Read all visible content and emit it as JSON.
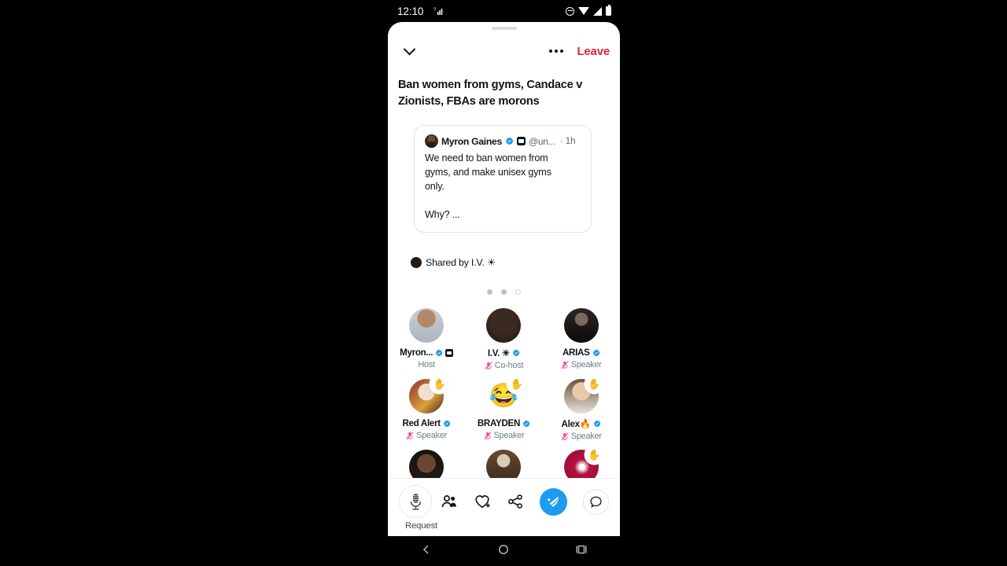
{
  "status_bar": {
    "time": "12:10",
    "icons": [
      "signal-small-icon",
      "do-not-disturb-icon",
      "wifi-icon",
      "cellular-icon",
      "battery-icon"
    ]
  },
  "header": {
    "collapse_icon": "chevron-down-icon",
    "more_icon": "more-horizontal-icon",
    "leave_label": "Leave",
    "leave_color": "#d72638"
  },
  "room": {
    "title": "Ban women from gyms, Candace v\nZionists, FBAs are morons"
  },
  "quoted_tweet": {
    "author": "Myron Gaines",
    "verified_icon": "verified-badge-icon",
    "affiliate_icon": "affiliate-badge-icon",
    "handle": "@un...",
    "timestamp": "· 1h",
    "body": "We need to ban women from\ngyms, and make unisex gyms\nonly.\n\nWhy? ..."
  },
  "shared_by": {
    "text": "Shared by I.V. ☀"
  },
  "pagination": {
    "dots": [
      "filled",
      "filled",
      "hollow"
    ]
  },
  "speakers": [
    [
      {
        "name": "Myron...",
        "role": "Host",
        "verified": true,
        "affiliate": true,
        "muted": false,
        "hand_raised": false,
        "avatar": "photo-man-beard",
        "avatar_kind": "photo"
      },
      {
        "name": "I.V. ☀",
        "role": "Co-host",
        "verified": true,
        "affiliate": false,
        "muted": true,
        "hand_raised": false,
        "avatar": "photo-dark",
        "avatar_kind": "photo"
      },
      {
        "name": "ARIAS",
        "role": "Speaker",
        "verified": true,
        "affiliate": false,
        "muted": true,
        "hand_raised": false,
        "avatar": "photo-figure-dark",
        "avatar_kind": "photo"
      }
    ],
    [
      {
        "name": "Red Alert",
        "role": "Speaker",
        "verified": true,
        "affiliate": false,
        "muted": true,
        "hand_raised": true,
        "avatar": "photo-clown",
        "avatar_kind": "photo"
      },
      {
        "name": "BRAYDEN",
        "role": "Speaker",
        "verified": true,
        "affiliate": false,
        "muted": true,
        "hand_raised": true,
        "avatar": "😂",
        "avatar_kind": "emoji"
      },
      {
        "name": "Alex🔥",
        "role": "Speaker",
        "verified": true,
        "affiliate": false,
        "muted": true,
        "hand_raised": true,
        "avatar": "photo-person",
        "avatar_kind": "photo"
      }
    ],
    [
      {
        "name": "",
        "role": "",
        "verified": false,
        "affiliate": false,
        "muted": false,
        "hand_raised": false,
        "avatar": "photo-woman",
        "avatar_kind": "photo"
      },
      {
        "name": "",
        "role": "",
        "verified": false,
        "affiliate": false,
        "muted": false,
        "hand_raised": false,
        "avatar": "photo-portrait",
        "avatar_kind": "photo"
      },
      {
        "name": "",
        "role": "",
        "verified": false,
        "affiliate": false,
        "muted": false,
        "hand_raised": true,
        "avatar": "photo-red-burst",
        "avatar_kind": "photo"
      }
    ]
  ],
  "action_bar": {
    "request_label": "Request",
    "mic_icon": "microphone-icon",
    "people_icon": "people-icon",
    "heart_plus_icon": "heart-plus-icon",
    "share_icon": "share-icon",
    "compose_icon": "compose-tweet-icon",
    "chat_icon": "chat-bubble-icon",
    "compose_color": "#1d9bf0"
  },
  "nav_bar": {
    "back_icon": "back-icon",
    "home_icon": "home-icon",
    "recents_icon": "recents-icon"
  },
  "theme": {
    "text_primary": "#0f1419",
    "text_secondary": "#536471",
    "twitter_blue": "#1d9bf0",
    "mute_pink": "#f0529c",
    "background": "#ffffff"
  }
}
